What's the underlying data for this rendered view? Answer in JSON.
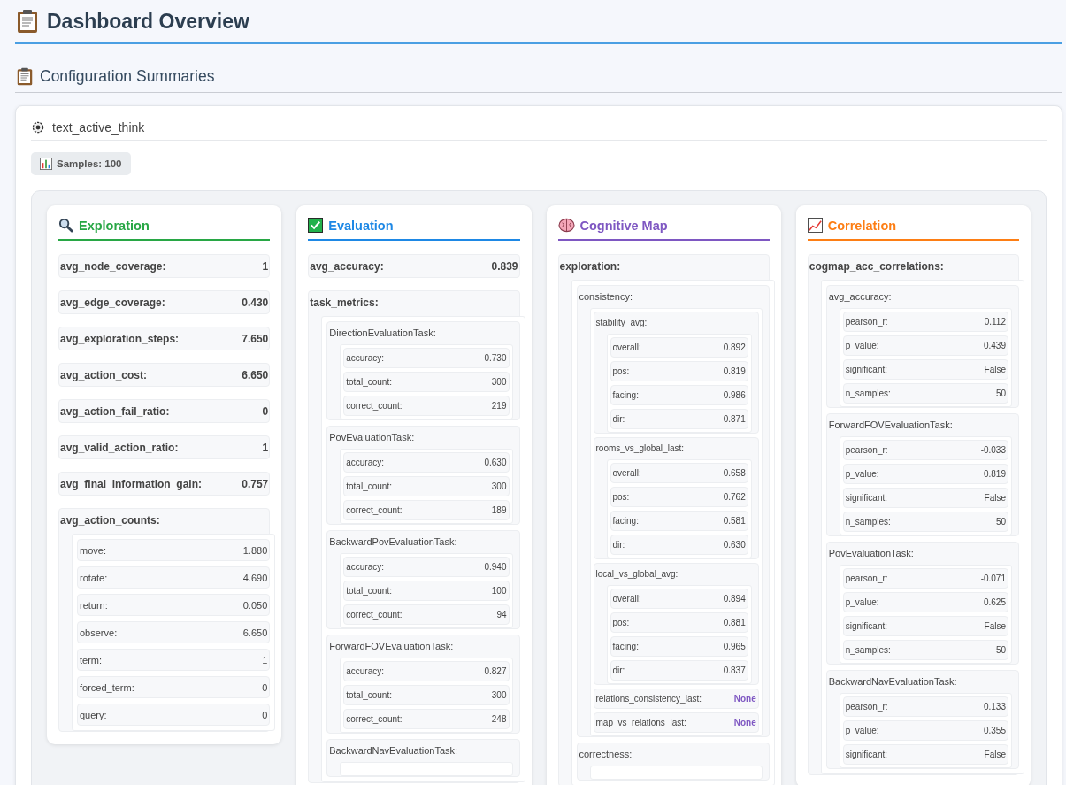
{
  "page_title": "Dashboard Overview",
  "section_title": "Configuration Summaries",
  "config": {
    "name": "text_active_think",
    "samples": "Samples: 100"
  },
  "cards": [
    {
      "title": "Exploration",
      "color": "#28a745",
      "items": [
        {
          "key": "avg_node_coverage:",
          "value": "1"
        },
        {
          "key": "avg_edge_coverage:",
          "value": "0.430"
        },
        {
          "key": "avg_exploration_steps:",
          "value": "7.650"
        },
        {
          "key": "avg_action_cost:",
          "value": "6.650"
        },
        {
          "key": "avg_action_fail_ratio:",
          "value": "0"
        },
        {
          "key": "avg_valid_action_ratio:",
          "value": "1"
        },
        {
          "key": "avg_final_information_gain:",
          "value": "0.757"
        },
        {
          "key": "avg_action_counts:",
          "children": [
            {
              "key": "move:",
              "value": "1.880"
            },
            {
              "key": "rotate:",
              "value": "4.690"
            },
            {
              "key": "return:",
              "value": "0.050"
            },
            {
              "key": "observe:",
              "value": "6.650"
            },
            {
              "key": "term:",
              "value": "1"
            },
            {
              "key": "forced_term:",
              "value": "0"
            },
            {
              "key": "query:",
              "value": "0"
            }
          ]
        }
      ]
    },
    {
      "title": "Evaluation",
      "color": "#1e88e5",
      "items": [
        {
          "key": "avg_accuracy:",
          "value": "0.839"
        },
        {
          "key": "task_metrics:",
          "children": [
            {
              "key": "DirectionEvaluationTask:",
              "children": [
                {
                  "key": "accuracy:",
                  "value": "0.730"
                },
                {
                  "key": "total_count:",
                  "value": "300"
                },
                {
                  "key": "correct_count:",
                  "value": "219"
                }
              ]
            },
            {
              "key": "PovEvaluationTask:",
              "children": [
                {
                  "key": "accuracy:",
                  "value": "0.630"
                },
                {
                  "key": "total_count:",
                  "value": "300"
                },
                {
                  "key": "correct_count:",
                  "value": "189"
                }
              ]
            },
            {
              "key": "BackwardPovEvaluationTask:",
              "children": [
                {
                  "key": "accuracy:",
                  "value": "0.940"
                },
                {
                  "key": "total_count:",
                  "value": "100"
                },
                {
                  "key": "correct_count:",
                  "value": "94"
                }
              ]
            },
            {
              "key": "ForwardFOVEvaluationTask:",
              "children": [
                {
                  "key": "accuracy:",
                  "value": "0.827"
                },
                {
                  "key": "total_count:",
                  "value": "300"
                },
                {
                  "key": "correct_count:",
                  "value": "248"
                }
              ]
            },
            {
              "key": "BackwardNavEvaluationTask:",
              "kind": "group"
            }
          ]
        }
      ]
    },
    {
      "title": "Cognitive Map",
      "color": "#7e57c2",
      "items": [
        {
          "key": "exploration:",
          "children": [
            {
              "key": "consistency:",
              "kind": "group",
              "children": [
                {
                  "key": "stability_avg:",
                  "kind": "group",
                  "children": [
                    {
                      "key": "overall:",
                      "value": "0.892"
                    },
                    {
                      "key": "pos:",
                      "value": "0.819"
                    },
                    {
                      "key": "facing:",
                      "value": "0.986"
                    },
                    {
                      "key": "dir:",
                      "value": "0.871"
                    }
                  ]
                },
                {
                  "key": "rooms_vs_global_last:",
                  "kind": "group",
                  "children": [
                    {
                      "key": "overall:",
                      "value": "0.658"
                    },
                    {
                      "key": "pos:",
                      "value": "0.762"
                    },
                    {
                      "key": "facing:",
                      "value": "0.581"
                    },
                    {
                      "key": "dir:",
                      "value": "0.630"
                    }
                  ]
                },
                {
                  "key": "local_vs_global_avg:",
                  "kind": "group",
                  "children": [
                    {
                      "key": "overall:",
                      "value": "0.894"
                    },
                    {
                      "key": "pos:",
                      "value": "0.881"
                    },
                    {
                      "key": "facing:",
                      "value": "0.965"
                    },
                    {
                      "key": "dir:",
                      "value": "0.837"
                    }
                  ]
                },
                {
                  "key": "relations_consistency_last:",
                  "kind": "null",
                  "value": "None"
                },
                {
                  "key": "map_vs_relations_last:",
                  "kind": "null",
                  "value": "None"
                }
              ]
            },
            {
              "key": "correctness:",
              "kind": "group"
            }
          ]
        }
      ]
    },
    {
      "title": "Correlation",
      "color": "#fd7e14",
      "items": [
        {
          "key": "cogmap_acc_correlations:",
          "children": [
            {
              "key": "avg_accuracy:",
              "children": [
                {
                  "key": "pearson_r:",
                  "value": "0.112"
                },
                {
                  "key": "p_value:",
                  "value": "0.439"
                },
                {
                  "key": "significant:",
                  "value": "False"
                },
                {
                  "key": "n_samples:",
                  "value": "50"
                }
              ]
            },
            {
              "key": "ForwardFOVEvaluationTask:",
              "children": [
                {
                  "key": "pearson_r:",
                  "value": "-0.033"
                },
                {
                  "key": "p_value:",
                  "value": "0.819"
                },
                {
                  "key": "significant:",
                  "value": "False"
                },
                {
                  "key": "n_samples:",
                  "value": "50"
                }
              ]
            },
            {
              "key": "PovEvaluationTask:",
              "children": [
                {
                  "key": "pearson_r:",
                  "value": "-0.071"
                },
                {
                  "key": "p_value:",
                  "value": "0.625"
                },
                {
                  "key": "significant:",
                  "value": "False"
                },
                {
                  "key": "n_samples:",
                  "value": "50"
                }
              ]
            },
            {
              "key": "BackwardNavEvaluationTask:",
              "children": [
                {
                  "key": "pearson_r:",
                  "value": "0.133"
                },
                {
                  "key": "p_value:",
                  "value": "0.355"
                },
                {
                  "key": "significant:",
                  "value": "False"
                }
              ]
            }
          ]
        }
      ]
    }
  ]
}
